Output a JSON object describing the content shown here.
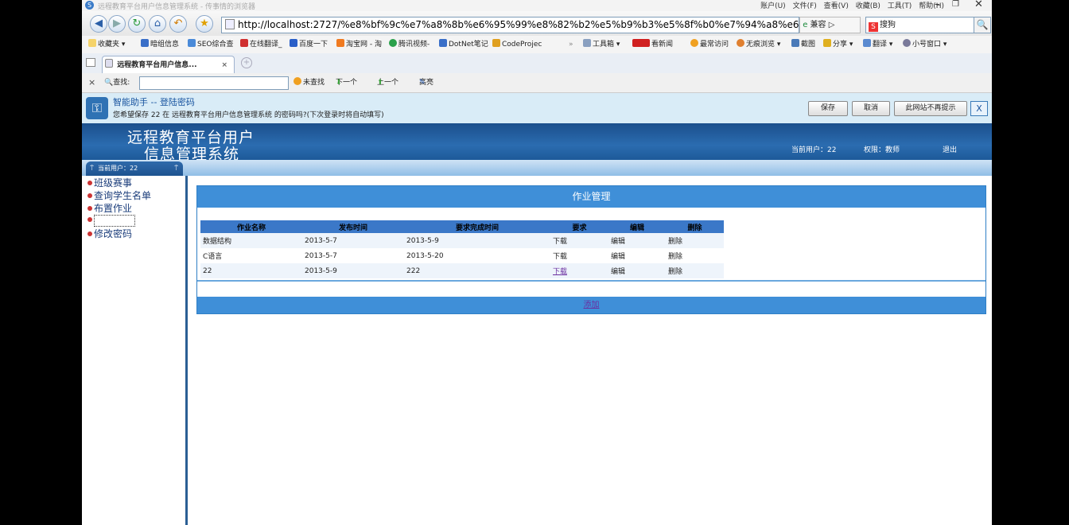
{
  "browser": {
    "window_title": "远程教育平台用户信息管理系统 - 传事情的浏览器",
    "menus": [
      "账户(U)",
      "文件(F)",
      "查看(V)",
      "收藏(B)",
      "工具(T)",
      "帮助(H)"
    ],
    "url": "http://localhost:2727/%e8%bf%9c%e7%a8%8b%e6%95%99%e8%82%b2%e5%b9%b3%e5%8f%b0%e7%94%a8%e6%88%b",
    "compat_label": "兼容",
    "search_engine": "搜狗",
    "favorites": [
      "收藏夹",
      "暗组信息",
      "SEO综合查",
      "在线翻译_",
      "百度一下",
      "淘宝网 - 淘",
      "腾讯视频-",
      "DotNet笔记",
      "CodeProjec",
      "工具箱",
      "看新闻",
      "最常访问",
      "无痕浏览",
      "截图",
      "分享",
      "翻译",
      "小号窗口"
    ],
    "tab_title": "远程教育平台用户信息...",
    "find": {
      "label": "查找:",
      "value": "",
      "not_found": "未查找",
      "next": "下一个",
      "prev": "上一个",
      "highlight": "高亮"
    }
  },
  "password_helper": {
    "title": "智能助手 -- 登陆密码",
    "message": "您希望保存 22 在 远程教育平台用户信息管理系统 的密码吗?(下次登录时将自动填写)",
    "save": "保存",
    "cancel": "取消",
    "never": "此网站不再提示",
    "close": "X"
  },
  "site": {
    "title_line1": "远程教育平台用户",
    "title_line2": "信息管理系统",
    "current_user": "当前用户：22",
    "permission": "权限：教师",
    "logout": "退出",
    "user_tab": "当前用户：22"
  },
  "sidebar": {
    "items": [
      {
        "label": "班级赛事"
      },
      {
        "label": "查询学生名单"
      },
      {
        "label": "布置作业"
      },
      {
        "label": ""
      },
      {
        "label": "修改密码"
      }
    ]
  },
  "panel": {
    "title": "作业管理",
    "columns": [
      "作业名称",
      "发布时间",
      "要求完成时间",
      "要求",
      "编辑",
      "删除"
    ],
    "rows": [
      {
        "name": "数据结构",
        "published": "2013-5-7",
        "due": "2013-5-9",
        "req": "下载",
        "edit": "编辑",
        "del": "删除"
      },
      {
        "name": "C语言",
        "published": "2013-5-7",
        "due": "2013-5-20",
        "req": "下载",
        "edit": "编辑",
        "del": "删除"
      },
      {
        "name": "22",
        "published": "2013-5-9",
        "due": "222",
        "req": "下载",
        "edit": "编辑",
        "del": "删除"
      }
    ],
    "add": "添加"
  }
}
